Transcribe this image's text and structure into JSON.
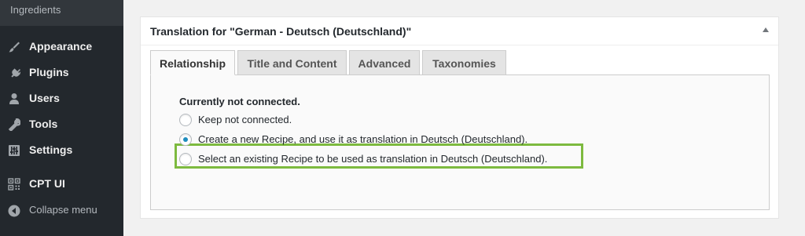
{
  "sidebar": {
    "submenu_label": "Ingredients",
    "items": [
      {
        "label": "Appearance",
        "icon": "paintbrush-icon"
      },
      {
        "label": "Plugins",
        "icon": "plug-icon"
      },
      {
        "label": "Users",
        "icon": "user-icon"
      },
      {
        "label": "Tools",
        "icon": "wrench-icon"
      },
      {
        "label": "Settings",
        "icon": "settings-sliders-icon"
      },
      {
        "label": "CPT UI",
        "icon": "grid-qr-icon"
      },
      {
        "label": "Collapse menu",
        "icon": "collapse-arrow-icon"
      }
    ]
  },
  "postbox": {
    "title": "Translation for \"German - Deutsch (Deutschland)\"",
    "tabs": [
      {
        "label": "Relationship",
        "active": true
      },
      {
        "label": "Title and Content",
        "active": false
      },
      {
        "label": "Advanced",
        "active": false
      },
      {
        "label": "Taxonomies",
        "active": false
      }
    ],
    "status": "Currently not connected.",
    "options": [
      {
        "label": "Keep not connected.",
        "checked": false
      },
      {
        "label": "Create a new Recipe, and use it as translation in Deutsch (Deutschland).",
        "checked": true
      },
      {
        "label": "Select an existing Recipe to be used as translation in Deutsch (Deutschland).",
        "checked": false
      }
    ]
  },
  "colors": {
    "sidebar_bg": "#23282d",
    "highlight_border": "#7dba3f",
    "radio_checked": "#1e8cbe"
  }
}
